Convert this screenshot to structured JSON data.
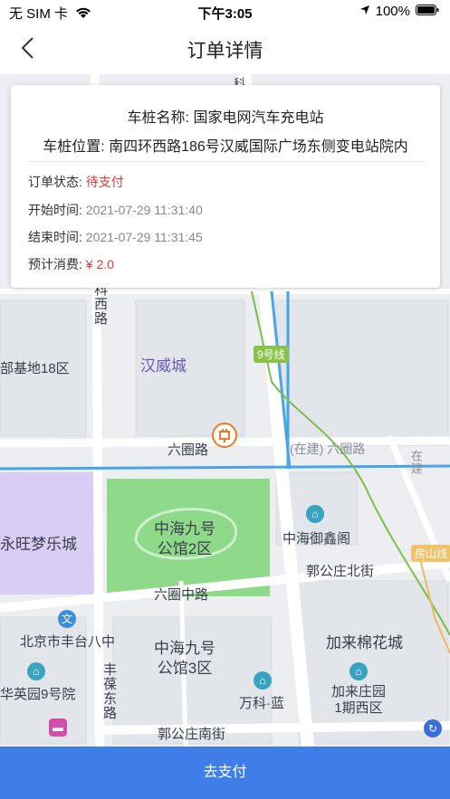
{
  "status_bar": {
    "carrier": "无 SIM 卡",
    "time": "下午3:05",
    "battery": "100%"
  },
  "nav": {
    "title": "订单详情",
    "back_icon": "chevron-left-icon"
  },
  "card": {
    "station_name": "车桩名称: 国家电网汽车充电站",
    "station_address": "车桩位置: 南四环西路186号汉威国际广场东侧变电站院内",
    "order_status_label": "订单状态:",
    "order_status_value": "待支付",
    "start_time_label": "开始时间:",
    "start_time_value": "2021-07-29 11:31:40",
    "end_time_label": "结束时间:",
    "end_time_value": "2021-07-29 11:31:45",
    "cost_label": "预计消费:",
    "cost_value": "¥ 2.0"
  },
  "map": {
    "labels": {
      "zhongke_xilu": "科西路",
      "jidi18": "部基地18区",
      "hanweicheng": "汉威城",
      "line9": "9号线",
      "liuquanlu": "六圈路",
      "liuquanlu_construction": "(在建) 六圈路",
      "zaijian": "在建",
      "yongwang": "永旺梦乐城",
      "zhonghai2": "中海九号\n公馆2区",
      "zhonghai_yuxin": "中海御鑫阁",
      "guogongzhuang_bei": "郭公庄北街",
      "fangshanxian": "房山线",
      "liuquanzhonglu": "六圈中路",
      "fengtai8": "北京市丰台八中",
      "zhonghai3": "中海九号\n公馆3区",
      "jialai_mianhua": "加来棉花城",
      "huayingyuan": "华英园9号院",
      "fengbao_donglu": "丰葆东路",
      "wanke": "万科·蓝",
      "jialai_zhuangyuan": "加来庄园\n1期西区",
      "guogongzhuang_nan": "郭公庄南街",
      "ke": "科"
    }
  },
  "footer": {
    "pay_label": "去支付"
  },
  "colors": {
    "accent": "#3f7ee8",
    "status_red": "#e33a3a",
    "park_green": "#8fd98b",
    "mall_purple": "#d9cdf5",
    "charger_orange": "#f07a22"
  }
}
